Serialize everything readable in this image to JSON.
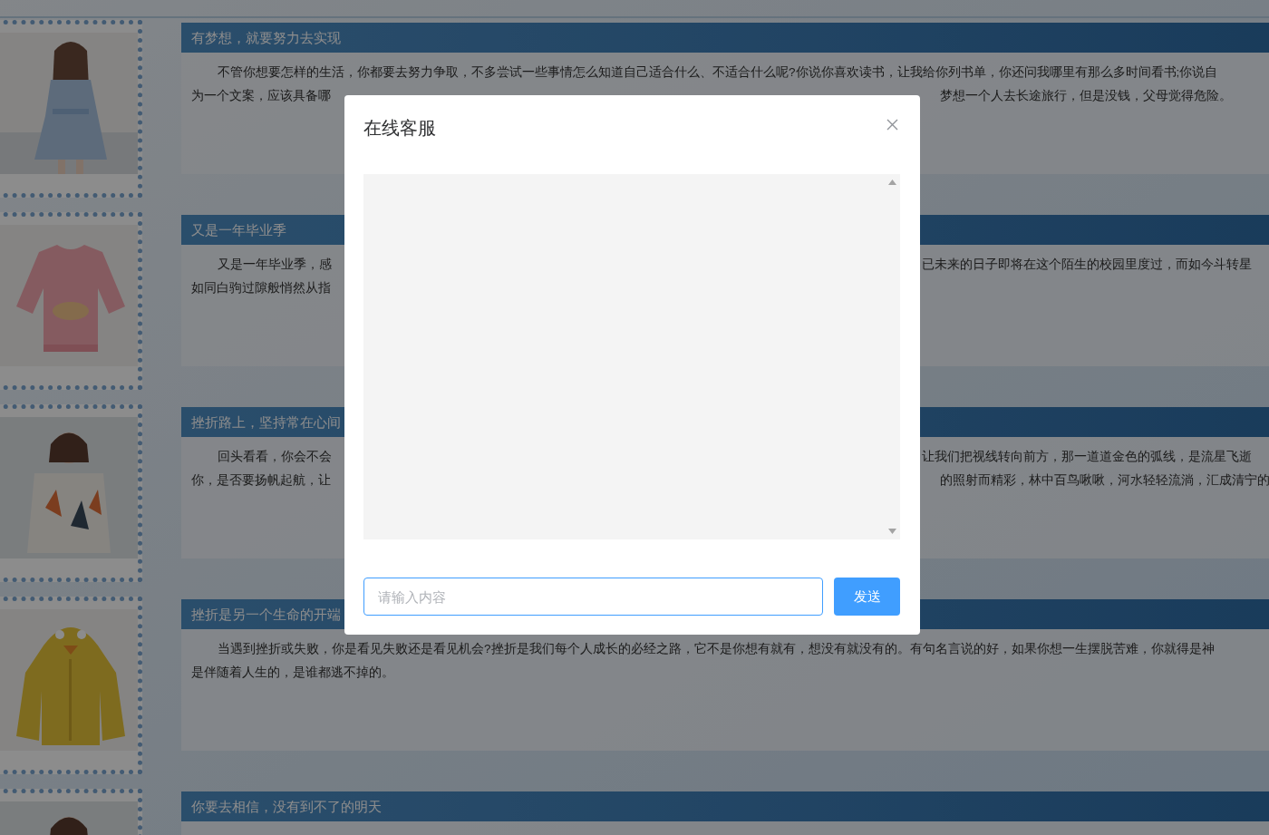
{
  "articles": [
    {
      "title": "有梦想，就要努力去实现",
      "lines": [
        {
          "left": "不管你想要怎样的生活，你都要去努力争取，不多尝试一些事情怎么知道自己适合什么、不适合什么呢?你说你喜欢读书，让我给你列书单，你还问我哪里有那么多时间看书;你说自"
        },
        {
          "left": "为一个文案，应该具备哪",
          "right": "梦想一个人去长途旅行，但是没钱，父母觉得危险。"
        }
      ]
    },
    {
      "title": "又是一年毕业季",
      "lines": [
        {
          "left": "又是一年毕业季，感",
          "right": "已未来的日子即将在这个陌生的校园里度过，而如今斗转星"
        },
        {
          "left": "如同白驹过隙般悄然从指"
        }
      ]
    },
    {
      "title": "挫折路上，坚持常在心间",
      "lines": [
        {
          "left": "回头看看，你会不会",
          "right": "让我们把视线转向前方，那一道道金色的弧线，是流星飞逝"
        },
        {
          "left": "你，是否要扬帆起航，让",
          "right": "的照射而精彩，林中百鸟啾啾，河水轻轻流淌，汇成清宁的"
        }
      ]
    },
    {
      "title": "挫折是另一个生命的开端",
      "lines": [
        {
          "left": "当遇到挫折或失败，你是看见失败还是看见机会?挫折是我们每个人成长的必经之路，它不是你想有就有，想没有就没有的。有句名言说的好，如果你想一生摆脱苦难，你就得是神"
        },
        {
          "left": "是伴随着人生的，是谁都逃不掉的。"
        }
      ]
    },
    {
      "title": "你要去相信，没有到不了的明天"
    }
  ],
  "dialog": {
    "title": "在线客服",
    "input": {
      "placeholder": "请输入内容"
    },
    "send_button": "发送"
  }
}
